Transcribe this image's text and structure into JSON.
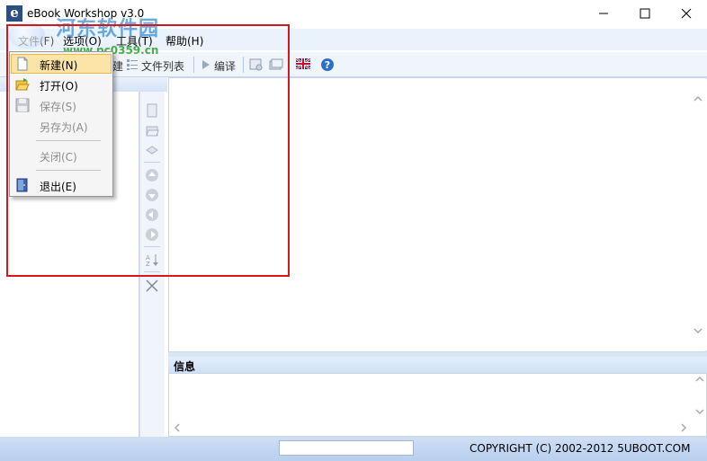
{
  "window": {
    "title": "eBook Workshop v3.0",
    "app_icon_letter": "e"
  },
  "menubar": {
    "items": [
      {
        "label": "文件(F)"
      },
      {
        "label": "选项(O)"
      },
      {
        "label": "工具(T)"
      },
      {
        "label": "帮助(H)"
      }
    ]
  },
  "toolbar": {
    "file_list_label": "文件列表",
    "compile_label": "编译",
    "partial_label": "建"
  },
  "file_menu": {
    "items": [
      {
        "label": "新建(N)",
        "enabled": true,
        "icon": "new-file-icon"
      },
      {
        "label": "打开(O)",
        "enabled": true,
        "icon": "open-folder-icon"
      },
      {
        "label": "保存(S)",
        "enabled": false,
        "icon": "save-icon"
      },
      {
        "label": "另存为(A)",
        "enabled": false,
        "icon": ""
      },
      {
        "label": "关闭(C)",
        "enabled": false,
        "icon": ""
      },
      {
        "label": "退出(E)",
        "enabled": true,
        "icon": "exit-icon"
      }
    ]
  },
  "info_panel": {
    "label": "信息"
  },
  "statusbar": {
    "copyright": "COPYRIGHT (C) 2002-2012 5UBOOT.COM",
    "field_value": ""
  },
  "watermark": {
    "text": "河东软件园",
    "url": "www.pc0359.cn"
  },
  "colors": {
    "highlight_box": "#d6181e",
    "menu_hover": "#fce4a8",
    "chrome": "#eaf2fb"
  }
}
